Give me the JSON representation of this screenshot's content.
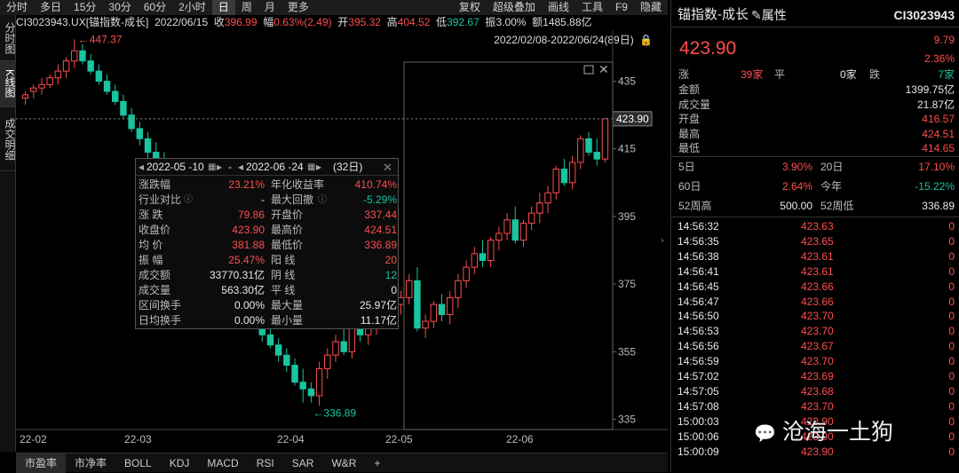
{
  "toolbar": {
    "left": [
      "分时",
      "多日",
      "15分",
      "30分",
      "60分",
      "2小时",
      "日",
      "周",
      "月",
      "更多"
    ],
    "active_index": 6,
    "right": [
      "复权",
      "超级叠加",
      "画线",
      "工具",
      "F9",
      "隐藏"
    ]
  },
  "info": {
    "code_name": "CI3023943.UX[锚指数-成长]",
    "date": "2022/06/15",
    "close_label": "收",
    "close": "396.99",
    "change_label": "幅",
    "change": "0.63%(2.49)",
    "open_label": "开",
    "open": "395.32",
    "high_label": "高",
    "high": "404.52",
    "low_label": "低",
    "low": "392.67",
    "amp_label": "振",
    "amp": "3.00%",
    "amount_label": "额",
    "amount": "1485.88亿"
  },
  "date_range": "2022/02/08-2022/06/24(89日)",
  "sidebar": [
    "分时图",
    "K线图",
    "成交明细"
  ],
  "sidebar_active": 1,
  "chart_data": {
    "type": "candlestick",
    "x_labels": [
      "22-02",
      "22-03",
      "22-04",
      "22-05",
      "22-06"
    ],
    "y_ticks": [
      435,
      415,
      395,
      375,
      355,
      335
    ],
    "y_range": [
      332,
      448
    ],
    "current_price": "423.90",
    "max_marker": "447.37",
    "min_marker": "336.89",
    "candles": [
      [
        430,
        432,
        428,
        431
      ],
      [
        432,
        434,
        430,
        433
      ],
      [
        433,
        436,
        431,
        434
      ],
      [
        434,
        437,
        433,
        436
      ],
      [
        436,
        440,
        434,
        438
      ],
      [
        438,
        442,
        436,
        441
      ],
      [
        441,
        447.37,
        439,
        444
      ],
      [
        444,
        446,
        440,
        441
      ],
      [
        441,
        443,
        437,
        438
      ],
      [
        438,
        440,
        434,
        435
      ],
      [
        435,
        437,
        431,
        432
      ],
      [
        432,
        434,
        428,
        429
      ],
      [
        429,
        431,
        424,
        425
      ],
      [
        425,
        427,
        420,
        421
      ],
      [
        421,
        423,
        416,
        418
      ],
      [
        418,
        420,
        412,
        414
      ],
      [
        414,
        417,
        409,
        411
      ],
      [
        411,
        414,
        405,
        407
      ],
      [
        407,
        410,
        401,
        403
      ],
      [
        403,
        406,
        397,
        399
      ],
      [
        399,
        402,
        393,
        395
      ],
      [
        395,
        398,
        389,
        391
      ],
      [
        391,
        394,
        385,
        387
      ],
      [
        387,
        390,
        381,
        383
      ],
      [
        383,
        386,
        377,
        379
      ],
      [
        379,
        382,
        373,
        375
      ],
      [
        375,
        378,
        369,
        371
      ],
      [
        371,
        374,
        366,
        368
      ],
      [
        368,
        370,
        362,
        364
      ],
      [
        364,
        366,
        358,
        360
      ],
      [
        360,
        362,
        356,
        357
      ],
      [
        357,
        359,
        352,
        354
      ],
      [
        354,
        356,
        349,
        351
      ],
      [
        351,
        353,
        345,
        346
      ],
      [
        346,
        350,
        340,
        344
      ],
      [
        344,
        346,
        340,
        342
      ],
      [
        342,
        352,
        339,
        350
      ],
      [
        350,
        356,
        347,
        354
      ],
      [
        354,
        360,
        352,
        358
      ],
      [
        358,
        362,
        354,
        355
      ],
      [
        355,
        366,
        353,
        364
      ],
      [
        364,
        367,
        358,
        360
      ],
      [
        360,
        365,
        357,
        363
      ],
      [
        363,
        368,
        360,
        366
      ],
      [
        366,
        374,
        364,
        372
      ],
      [
        372,
        375,
        367,
        369
      ],
      [
        369,
        373,
        366,
        371
      ],
      [
        371,
        378,
        369,
        376
      ],
      [
        376,
        380,
        361,
        362
      ],
      [
        362,
        366,
        359,
        364
      ],
      [
        364,
        370,
        362,
        369
      ],
      [
        369,
        372,
        364,
        366
      ],
      [
        366,
        373,
        363,
        371
      ],
      [
        371,
        378,
        368,
        376
      ],
      [
        376,
        382,
        374,
        380
      ],
      [
        380,
        386,
        378,
        384
      ],
      [
        384,
        388,
        380,
        382
      ],
      [
        382,
        389,
        380,
        388
      ],
      [
        388,
        392,
        385,
        390
      ],
      [
        390,
        396,
        388,
        394
      ],
      [
        394,
        398,
        387,
        388
      ],
      [
        388,
        394,
        386,
        393
      ],
      [
        393,
        398,
        391,
        396
      ],
      [
        396,
        402,
        393,
        399
      ],
      [
        399,
        404,
        396,
        402
      ],
      [
        402,
        410,
        400,
        409
      ],
      [
        409,
        412,
        404,
        405
      ],
      [
        405,
        413,
        403,
        411
      ],
      [
        411,
        419,
        409,
        418
      ],
      [
        418,
        420,
        413,
        414
      ],
      [
        414,
        418,
        410,
        412
      ],
      [
        412,
        424,
        411,
        423.9
      ]
    ]
  },
  "tooltip": {
    "start": "2022-05 -10",
    "dash": "-",
    "end": "2022-06 -24",
    "days": "(32日)",
    "rows": [
      {
        "l1": "涨跌幅",
        "v1": "23.21%",
        "c1": "red",
        "l2": "年化收益率",
        "v2": "410.74%",
        "c2": "red"
      },
      {
        "l1": "行业对比",
        "v1": "-",
        "c1": "white",
        "l2": "最大回撤",
        "v2": "-5.29%",
        "c2": "green"
      },
      {
        "l1": "涨 跌",
        "v1": "79.86",
        "c1": "red",
        "l2": "开盘价",
        "v2": "337.44",
        "c2": "red"
      },
      {
        "l1": "收盘价",
        "v1": "423.90",
        "c1": "red",
        "l2": "最高价",
        "v2": "424.51",
        "c2": "red"
      },
      {
        "l1": "均 价",
        "v1": "381.88",
        "c1": "red",
        "l2": "最低价",
        "v2": "336.89",
        "c2": "red"
      },
      {
        "l1": "振 幅",
        "v1": "25.47%",
        "c1": "red",
        "l2": "阳 线",
        "v2": "20",
        "c2": "red"
      },
      {
        "l1": "成交额",
        "v1": "33770.31亿",
        "c1": "white",
        "l2": "阴 线",
        "v2": "12",
        "c2": "green"
      },
      {
        "l1": "成交量",
        "v1": "563.30亿",
        "c1": "white",
        "l2": "平 线",
        "v2": "0",
        "c2": "white"
      },
      {
        "l1": "区间换手",
        "v1": "0.00%",
        "c1": "white",
        "l2": "最大量",
        "v2": "25.97亿",
        "c2": "white"
      },
      {
        "l1": "日均换手",
        "v1": "0.00%",
        "c1": "white",
        "l2": "最小量",
        "v2": "11.17亿",
        "c2": "white"
      }
    ]
  },
  "bottombar": [
    "市盈率",
    "市净率",
    "BOLL",
    "KDJ",
    "MACD",
    "RSI",
    "SAR",
    "W&R",
    "+"
  ],
  "quote": {
    "name": "锚指数-成长",
    "attr_label": "属性",
    "code": "CI3023943",
    "price": "423.90",
    "change": "9.79",
    "change_pct": "2.36%",
    "up_label": "涨",
    "up_count": "39家",
    "flat_label": "平",
    "flat_count": "0家",
    "down_label": "跌",
    "down_count": "7家",
    "stats": [
      {
        "l": "金额",
        "v": "1399.75亿",
        "c": "white"
      },
      {
        "l": "成交量",
        "v": "21.87亿",
        "c": "white"
      },
      {
        "l": "开盘",
        "v": "416.57",
        "c": "red"
      },
      {
        "l": "最高",
        "v": "424.51",
        "c": "red"
      },
      {
        "l": "最低",
        "v": "414.65",
        "c": "red"
      }
    ],
    "periods": [
      {
        "l1": "5日",
        "v1": "3.90%",
        "c1": "red",
        "l2": "20日",
        "v2": "17.10%",
        "c2": "red"
      },
      {
        "l1": "60日",
        "v1": "2.64%",
        "c1": "red",
        "l2": "今年",
        "v2": "-15.22%",
        "c2": "green"
      },
      {
        "l1": "52周高",
        "v1": "500.00",
        "c1": "white",
        "l2": "52周低",
        "v2": "336.89",
        "c2": "white"
      }
    ],
    "ticks": [
      {
        "t": "14:56:32",
        "p": "423.63",
        "v": "0"
      },
      {
        "t": "14:56:35",
        "p": "423.65",
        "v": "0"
      },
      {
        "t": "14:56:38",
        "p": "423.61",
        "v": "0"
      },
      {
        "t": "14:56:41",
        "p": "423.61",
        "v": "0"
      },
      {
        "t": "14:56:45",
        "p": "423.66",
        "v": "0"
      },
      {
        "t": "14:56:47",
        "p": "423.66",
        "v": "0"
      },
      {
        "t": "14:56:50",
        "p": "423.70",
        "v": "0"
      },
      {
        "t": "14:56:53",
        "p": "423.70",
        "v": "0"
      },
      {
        "t": "14:56:56",
        "p": "423.67",
        "v": "0"
      },
      {
        "t": "14:56:59",
        "p": "423.70",
        "v": "0"
      },
      {
        "t": "14:57:02",
        "p": "423.69",
        "v": "0"
      },
      {
        "t": "14:57:05",
        "p": "423.68",
        "v": "0"
      },
      {
        "t": "14:57:08",
        "p": "423.70",
        "v": "0"
      },
      {
        "t": "15:00:03",
        "p": "423.90",
        "v": "0"
      },
      {
        "t": "15:00:06",
        "p": "423.90",
        "v": "0"
      },
      {
        "t": "15:00:09",
        "p": "423.90",
        "v": "0"
      }
    ]
  },
  "watermark": "沧海一土狗",
  "colors": {
    "up": "#ff4d4d",
    "down": "#19c4a0"
  }
}
